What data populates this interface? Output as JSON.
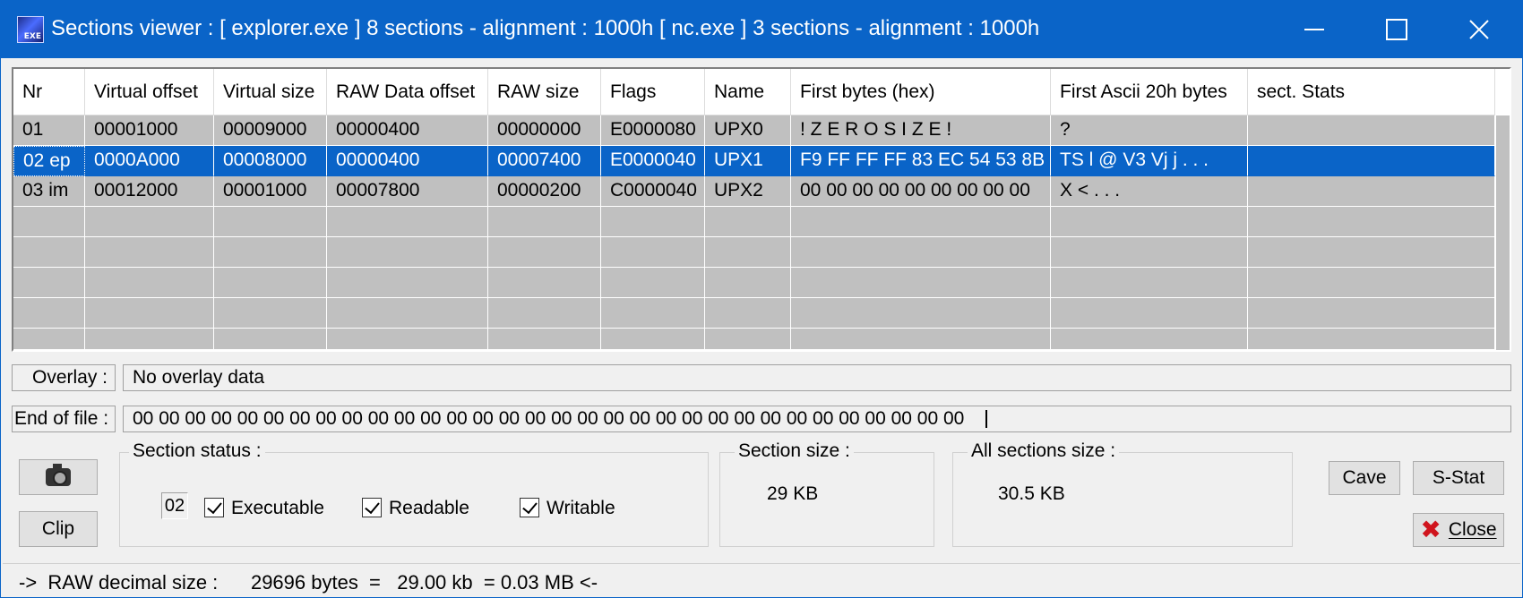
{
  "window": {
    "title": "Sections viewer :  [ explorer.exe ] 8 sections - alignment : 1000h [ nc.exe ] 3 sections - alignment : 1000h",
    "accent_color": "#0a64c8"
  },
  "table": {
    "columns": [
      "Nr",
      "Virtual offset",
      "Virtual size",
      "RAW Data offset",
      "RAW size",
      "Flags",
      "Name",
      "First bytes (hex)",
      "First Ascii 20h bytes",
      "sect. Stats"
    ],
    "rows": [
      [
        "01",
        "00001000",
        "00009000",
        "00000400",
        "00000000",
        "E0000080",
        "UPX0",
        " ! Z E R O   S I Z E !",
        "?",
        ""
      ],
      [
        "02 ep",
        "0000A000",
        "00008000",
        "00000400",
        "00007400",
        "E0000040",
        "UPX1",
        "F9 FF FF FF 83 EC 54 53 8B",
        "    TS l @ V3 Vj   j . . .",
        ""
      ],
      [
        "03 im",
        "00012000",
        "00001000",
        "00007800",
        "00000200",
        "C0000040",
        "UPX2",
        "00 00 00 00 00 00 00 00 00",
        "        X     <          . . .",
        ""
      ]
    ],
    "selected_row": 1
  },
  "overlay": {
    "label": "Overlay :",
    "value": "No overlay data"
  },
  "eof": {
    "label": "End of file :",
    "value": "00 00 00 00 00 00 00 00 00 00 00 00 00 00 00 00 00 00 00 00 00 00 00 00 00 00 00 00 00 00 00 00"
  },
  "buttons": {
    "camera_icon": "camera-icon",
    "clip": "Clip",
    "cave": "Cave",
    "sstat": "S-Stat",
    "close": "Close",
    "close_icon": "red-x-icon"
  },
  "section_status": {
    "title": "Section status :",
    "number": "02",
    "executable": "Executable",
    "readable": "Readable",
    "writable": "Writable"
  },
  "section_size": {
    "title": "Section size :",
    "value": "29 KB"
  },
  "all_sections_size": {
    "title": "All sections size :",
    "value": "30.5 KB"
  },
  "status_bar": {
    "text": "->  RAW decimal size :      29696 bytes  =   29.00 kb  = 0.03 MB <-"
  }
}
